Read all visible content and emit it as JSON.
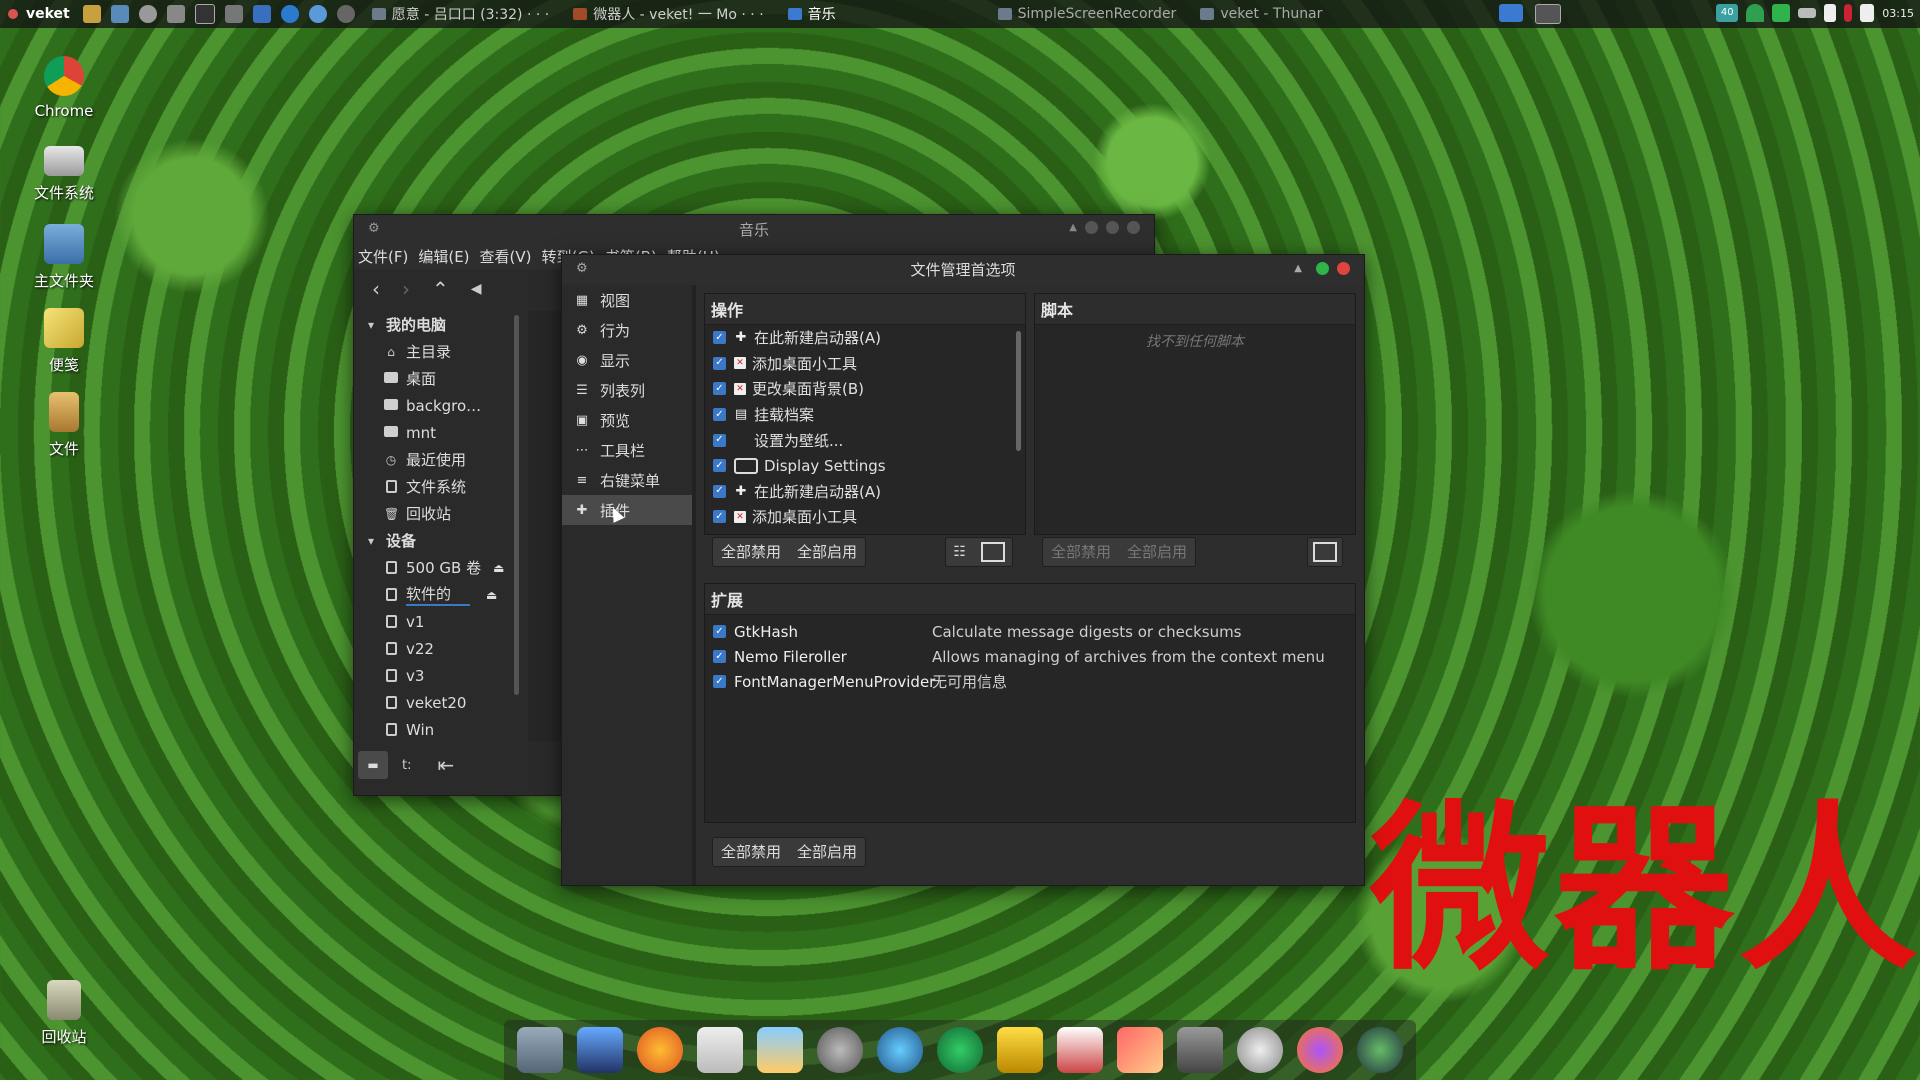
{
  "top_panel": {
    "menu_label": "veket",
    "tasks": [
      {
        "label": "愿意 - 吕口口 (3:32) · · ·"
      },
      {
        "label": "微器人 - veket! 一 Mo · · ·"
      },
      {
        "label": "音乐"
      },
      {
        "label": "SimpleScreenRecorder"
      },
      {
        "label": "veket - Thunar"
      }
    ],
    "clock": "03:15",
    "tray_badge": "40"
  },
  "desktop_icons": [
    {
      "label": "Chrome"
    },
    {
      "label": "文件系统"
    },
    {
      "label": "主文件夹"
    },
    {
      "label": "便笺"
    },
    {
      "label": "文件"
    },
    {
      "label": "回收站"
    }
  ],
  "music_window": {
    "title": "音乐",
    "menu": [
      "文件(F)",
      "编辑(E)",
      "查看(V)",
      "转到(G)",
      "书签(B)",
      "帮助(H)"
    ],
    "sidebar": {
      "sections": [
        {
          "header": "我的电脑",
          "items": [
            "主目录",
            "桌面",
            "backgro…",
            "mnt",
            "最近使用",
            "文件系统",
            "回收站"
          ]
        },
        {
          "header": "设备",
          "items": [
            "500 GB 卷",
            "软件的",
            "v1",
            "v22",
            "v3",
            "veket20",
            "Win"
          ]
        }
      ]
    },
    "bottom_left_label": "t:"
  },
  "prefs_window": {
    "title": "文件管理首选项",
    "nav": [
      "视图",
      "行为",
      "显示",
      "列表列",
      "预览",
      "工具栏",
      "右键菜单",
      "插件"
    ],
    "selected_nav": "插件",
    "actions": {
      "header": "操作",
      "items": [
        "在此新建启动器(A)",
        "添加桌面小工具",
        "更改桌面背景(B)",
        "挂载档案",
        "设置为壁纸...",
        "Display Settings",
        "在此新建启动器(A)",
        "添加桌面小工具"
      ],
      "disable_all": "全部禁用",
      "enable_all": "全部启用"
    },
    "scripts": {
      "header": "脚本",
      "empty_text": "找不到任何脚本",
      "disable_all": "全部禁用",
      "enable_all": "全部启用"
    },
    "extensions": {
      "header": "扩展",
      "items": [
        {
          "name": "GtkHash",
          "desc": "Calculate message digests or checksums"
        },
        {
          "name": "Nemo Fileroller",
          "desc": "Allows managing of archives from the context menu"
        },
        {
          "name": "FontManagerMenuProvider",
          "desc": "无可用信息"
        }
      ],
      "disable_all": "全部禁用",
      "enable_all": "全部启用"
    }
  },
  "watermark_text": "微器人",
  "colors": {
    "accent": "#3b78c6",
    "close": "#e0443e",
    "maximize": "#2fb34a",
    "watermark": "#e01010"
  }
}
